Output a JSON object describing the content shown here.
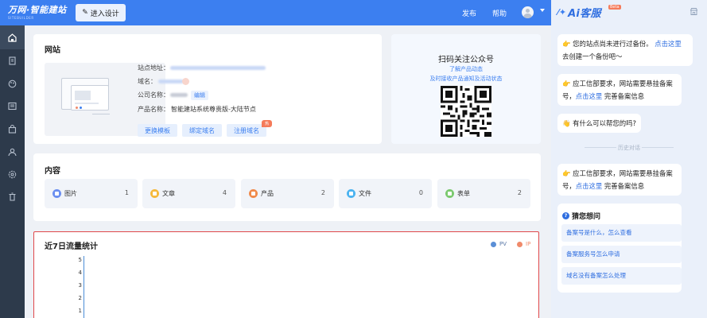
{
  "topbar": {
    "brand": "万网·智能建站",
    "brand_sub": "SITEBUILDER",
    "enter_design": "进入设计",
    "publish": "发布",
    "help": "帮助"
  },
  "website": {
    "title": "网站",
    "labels": {
      "site_url": "站点地址：",
      "domain": "域名：",
      "company": "公司名称：",
      "product": "产品名称："
    },
    "product_value": "智能建站系统尊贵版-大陆节点",
    "edit": "编辑",
    "buttons": {
      "change_template": "更换模板",
      "bind_domain": "绑定域名",
      "register_domain": "注册域名"
    },
    "hot_badge": "热"
  },
  "qr": {
    "title": "扫码关注公众号",
    "line1": "了解产品动态",
    "line2": "及时接收产品通知及活动状态"
  },
  "content": {
    "title": "内容",
    "items": [
      {
        "label": "图片",
        "count": "1",
        "color": "#6b8ff0"
      },
      {
        "label": "文章",
        "count": "4",
        "color": "#f5b93c"
      },
      {
        "label": "产品",
        "count": "2",
        "color": "#f08a4b"
      },
      {
        "label": "文件",
        "count": "0",
        "color": "#4cb3f0"
      },
      {
        "label": "表单",
        "count": "2",
        "color": "#7bc96f"
      }
    ]
  },
  "traffic": {
    "title": "近7日流量统计",
    "legend": [
      {
        "name": "PV",
        "color": "#5b8fd6"
      },
      {
        "name": "IP",
        "color": "#f08a6a"
      }
    ],
    "yticks": [
      "5",
      "4",
      "3",
      "2",
      "1"
    ]
  },
  "chat": {
    "brand": "Ai客服",
    "beta": "Beta",
    "messages": [
      {
        "emoji": "👉",
        "line1_text": "您的站点尚未进行过备份。",
        "line1_link": "点击这里",
        "line2_text": "去创建一个备份吧～"
      },
      {
        "emoji": "👉",
        "line1_text": "应工信部要求，网站需要悬挂备案",
        "line2_text_pre": "号，",
        "line2_link": "点击这里",
        "line2_text_post": " 完善备案信息"
      },
      {
        "emoji": "👋",
        "line1_text": "有什么可以帮您的吗?"
      },
      {
        "emoji": "👉",
        "line1_text": "应工信部要求，网站需要悬挂备案",
        "line2_text_pre": "号，",
        "line2_link": "点击这里",
        "line2_text_post": " 完善备案信息"
      }
    ],
    "history_label": "历史对话",
    "guess": {
      "title": "猜您想问",
      "items": [
        "备案号是什么，怎么查看",
        "备案服务号怎么申请",
        "域名没有备案怎么处理"
      ]
    }
  }
}
